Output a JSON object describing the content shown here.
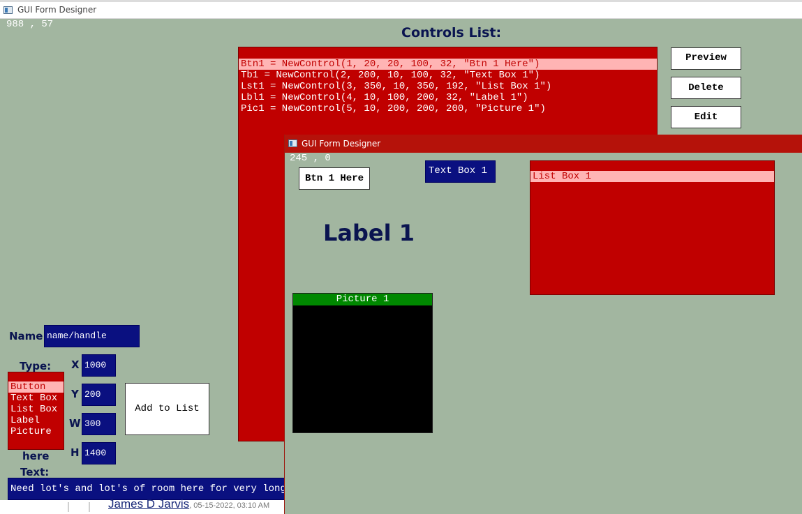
{
  "main_window": {
    "title": "GUI Form Designer",
    "mouse_coords": "988 , 57",
    "controls_title": "Controls List:",
    "controls_list": [
      "Btn1 = NewControl(1, 20, 20, 100, 32, \"Btn 1 Here\")",
      "Tb1 = NewControl(2, 200, 10, 100, 32, \"Text Box 1\")",
      "Lst1 = NewControl(3, 350, 10, 350, 192, \"List Box 1\")",
      "Lbl1 = NewControl(4, 10, 100, 200, 32, \"Label 1\")",
      "Pic1 = NewControl(5, 10, 200, 200, 200, \"Picture 1\")"
    ],
    "selected_index": 0,
    "buttons": {
      "preview": "Preview",
      "delete": "Delete",
      "edit": "Edit",
      "add_to_list": "Add to List"
    },
    "form": {
      "name_label": "Name",
      "name_value": "name/handle",
      "type_label": "Type:",
      "types": [
        "Button",
        "Text Box",
        "List Box",
        "Label",
        "Picture"
      ],
      "selected_type": "Button",
      "x_label": "X",
      "x_value": "1000",
      "y_label": "Y",
      "y_value": "200",
      "w_label": "W",
      "w_value": "300",
      "h_label": "H",
      "h_value": "1400",
      "here_label": "here",
      "text_label": "Text:",
      "text_value": "Need lot's and lot's of room here for very long l"
    }
  },
  "preview_window": {
    "title": "GUI Form Designer",
    "mouse_coords": "245 , 0",
    "button_text": "Btn 1 Here",
    "textbox_text": "Text Box 1",
    "label_text": "Label 1",
    "listbox_items": [
      "List Box 1"
    ],
    "picture_title": "Picture 1"
  },
  "background_page": {
    "author": "James D Jarvis",
    "date": ", 05-15-2022, 03:10 AM"
  },
  "colors": {
    "form_bg": "#a2b6a0",
    "list_red": "#c00000",
    "list_selected": "#ffb4b4",
    "input_navy": "#0a1080",
    "label_navy": "#0a1450",
    "picture_title_green": "#008800",
    "preview_titlebar": "#b5120a"
  }
}
